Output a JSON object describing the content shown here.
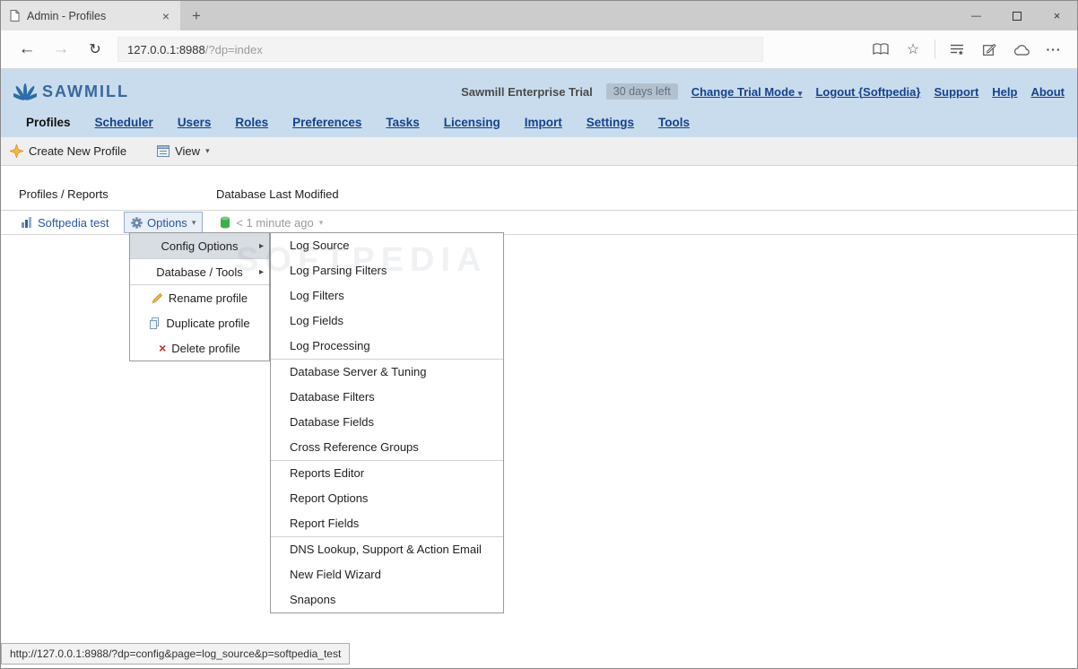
{
  "window": {
    "tab_title": "Admin - Profiles"
  },
  "browser": {
    "url_host": "127.0.0.1:8988",
    "url_rest": "/?dp=index"
  },
  "header": {
    "logo": "SAWMILL",
    "trial_label": "Sawmill Enterprise Trial",
    "days_left": "30 days left",
    "change_trial": "Change Trial Mode",
    "logout": "Logout {Softpedia}",
    "support": "Support",
    "help": "Help",
    "about": "About"
  },
  "nav": {
    "active": "Profiles",
    "items": [
      "Profiles",
      "Scheduler",
      "Users",
      "Roles",
      "Preferences",
      "Tasks",
      "Licensing",
      "Import",
      "Settings",
      "Tools"
    ]
  },
  "toolbar": {
    "create": "Create New Profile",
    "view": "View"
  },
  "list": {
    "header_profiles": "Profiles / Reports",
    "header_modified": "Database Last Modified",
    "profile_name": "Softpedia test",
    "options": "Options",
    "modified": "< 1 minute ago"
  },
  "menu": {
    "config_options": "Config Options",
    "database_tools": "Database / Tools",
    "rename": "Rename profile",
    "duplicate": "Duplicate profile",
    "delete": "Delete profile"
  },
  "submenu": {
    "groups": [
      [
        "Log Source",
        "Log Parsing Filters",
        "Log Filters",
        "Log Fields",
        "Log Processing"
      ],
      [
        "Database Server & Tuning",
        "Database Filters",
        "Database Fields",
        "Cross Reference Groups"
      ],
      [
        "Reports Editor",
        "Report Options",
        "Report Fields"
      ],
      [
        "DNS Lookup, Support & Action Email",
        "New Field Wizard",
        "Snapons"
      ]
    ]
  },
  "statusbar": {
    "url": "http://127.0.0.1:8988/?dp=config&page=log_source&p=softpedia_test"
  },
  "watermark": "SOFTPEDIA",
  "icons": {
    "back": "←",
    "forward": "→",
    "refresh": "↻",
    "star": "☆",
    "more": "···",
    "caret_down": "▾",
    "caret_right": "▸",
    "close": "×",
    "minimize": "—",
    "plus": "+",
    "delete_x": "×"
  },
  "colors": {
    "header_bg": "#c9dcee",
    "link_blue": "#15428b",
    "profile_link": "#2a56a8",
    "menu_highlight": "#d8dde3",
    "badge_bg": "#b3c1cf"
  }
}
